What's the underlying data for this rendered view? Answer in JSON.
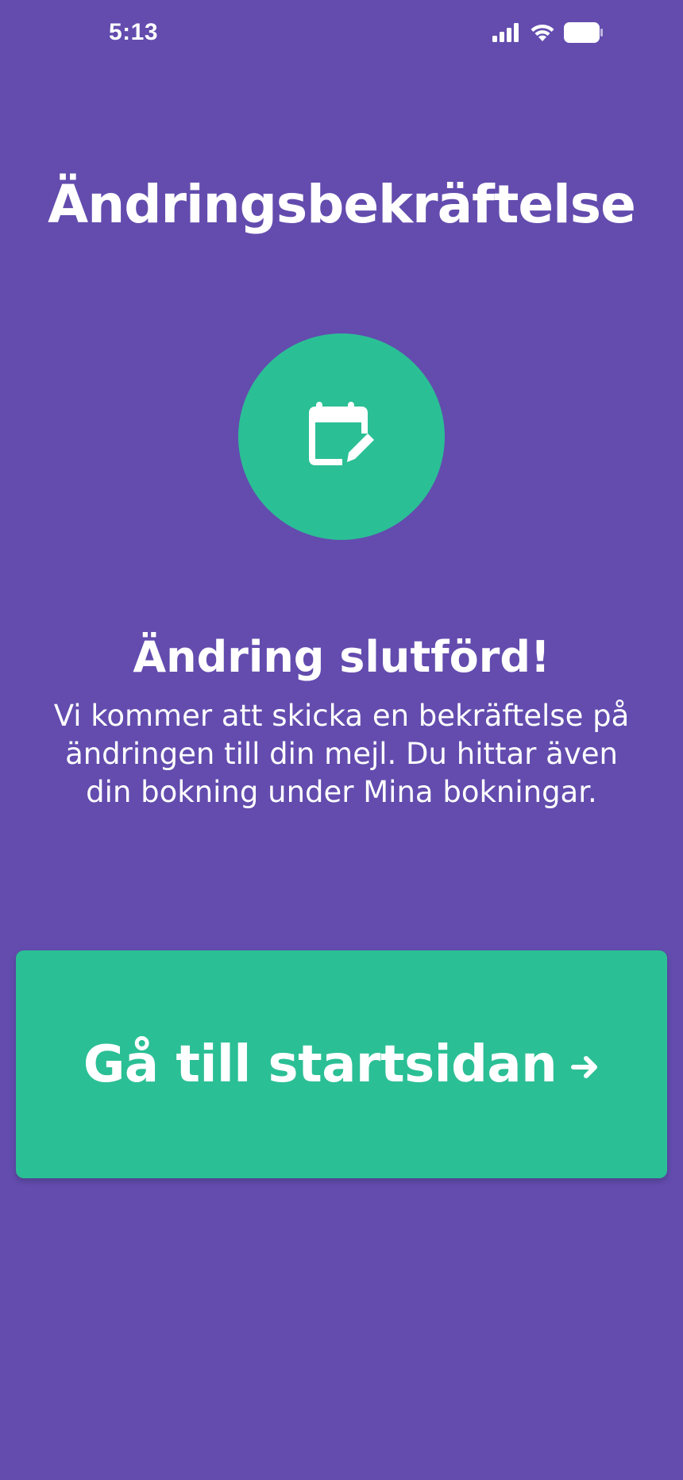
{
  "status_bar": {
    "time": "5:13",
    "icons": [
      "signal-icon",
      "wifi-icon",
      "battery-icon"
    ]
  },
  "header": {
    "title": "Ändringsbekräftelse"
  },
  "hero": {
    "icon": "calendar-edit-icon",
    "circle_color": "#2BBF95"
  },
  "confirmation": {
    "heading": "Ändring slutförd!",
    "message": "Vi kommer att skicka en bekräftelse på ändringen till din mejl. Du hittar även din bokning under Mina bokningar."
  },
  "primary_action": {
    "label": "Gå till startsidan",
    "icon": "arrow-right-icon"
  },
  "colors": {
    "background": "#634CAE",
    "accent": "#2BBF95",
    "text": "#FFFFFF"
  }
}
